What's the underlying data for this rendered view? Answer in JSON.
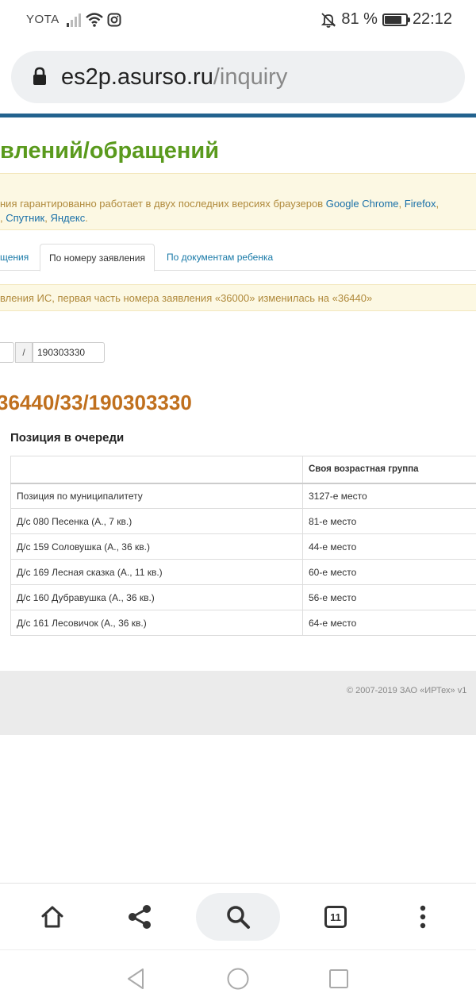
{
  "status_bar": {
    "carrier": "YOTA",
    "battery_percent": "81 %",
    "battery_level": 0.81,
    "time": "22:12"
  },
  "browser": {
    "url_domain": "es2p.asurso.ru",
    "url_path": "/inquiry"
  },
  "page": {
    "title": "влений/обращений",
    "warning": {
      "line1_text": "ния гарантированно работает в двух последних версиях браузеров ",
      "link_chrome": "Google Chrome",
      "sep1": ", ",
      "link_firefox": "Firefox",
      "sep2": ",",
      "line2_prefix": ", ",
      "link_sputnik": "Спутник",
      "sep3": ", ",
      "link_yandex": "Яндекс",
      "line2_end": "."
    },
    "tabs": [
      {
        "label": "щения"
      },
      {
        "label": "По номеру заявления"
      },
      {
        "label": "По документам ребенка"
      }
    ],
    "info_text": "вления ИС, первая часть номера заявления «36000» изменилась на «36440»",
    "number_form": {
      "separator": "/",
      "value": "190303330"
    },
    "application_number": "36440/33/190303330",
    "queue": {
      "title": "Позиция в очереди",
      "columns": [
        "",
        "Своя возрастная группа"
      ],
      "rows": [
        [
          "Позиция по муниципалитету",
          "3127-е место"
        ],
        [
          "Д/с 080 Песенка (А., 7 кв.)",
          "81-е место"
        ],
        [
          "Д/с 159 Соловушка (А., 36 кв.)",
          "44-е место"
        ],
        [
          "Д/с 169 Лесная сказка (А., 11 кв.)",
          "60-е место"
        ],
        [
          "Д/с 160 Дубравушка (А., 36 кв.)",
          "56-е место"
        ],
        [
          "Д/с 161 Лесовичок (А., 36 кв.)",
          "64-е место"
        ]
      ]
    },
    "footer": "© 2007-2019 ЗАО «ИРТех» v1"
  },
  "toolbar": {
    "tabs_count": "11",
    "icons": [
      "home-icon",
      "share-icon",
      "search-icon",
      "tabs-icon",
      "more-icon"
    ]
  },
  "colors": {
    "title_green": "#5a9a1d",
    "number_orange": "#c0701e",
    "link_blue": "#1a70a8",
    "top_rule": "#22628e",
    "warning_bg": "#fcf8e3"
  }
}
